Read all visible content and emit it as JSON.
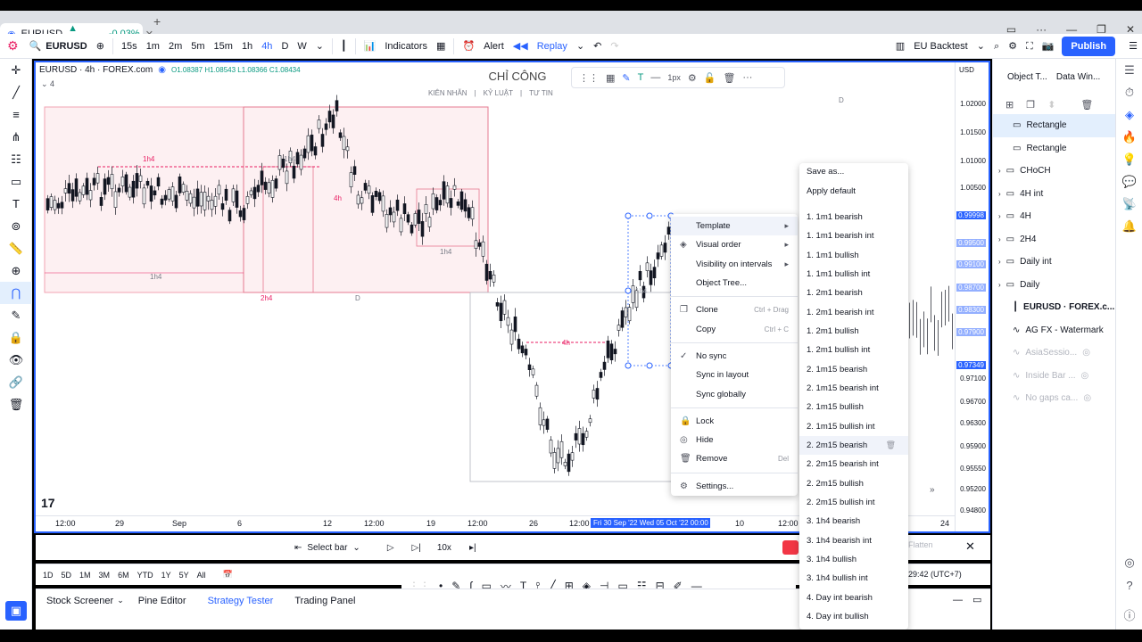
{
  "browser": {
    "tab_title": "EURUSD",
    "tab_price": "▲ 1.09552",
    "tab_change": "-0.03%"
  },
  "header": {
    "symbol": "EURUSD",
    "intervals": [
      "15s",
      "1m",
      "2m",
      "5m",
      "15m",
      "1h",
      "4h",
      "D",
      "W"
    ],
    "indicators_label": "Indicators",
    "alert_label": "Alert",
    "replay_label": "Replay",
    "layout_name": "EU Backtest",
    "publish_label": "Publish"
  },
  "chart": {
    "legend_symbol": "EURUSD · 4h · FOREX.com",
    "ohlc": "O1.08387 H1.08543 L1.08366 C1.08434",
    "indicator_count": "4",
    "watermark_title": "CHỈ CÔNG",
    "watermark_sub": [
      "KIÊN NHẪN",
      "KỶ LUẬT",
      "TƯ TIN"
    ],
    "currency": "USD",
    "labels": {
      "d_top": "D",
      "h4_a": "1h4",
      "h4_b": "1h4",
      "h4_c": "2h4",
      "d_mid": "D",
      "h4_d": "1h4",
      "h4_e": "1h4",
      "h4_f": "4h",
      "h4_g": "1h4",
      "h4_h": "4h"
    }
  },
  "price_axis": [
    "1.02000",
    "1.01500",
    "1.01000",
    "1.00500",
    "0.99998",
    "0.99500",
    "0.99100",
    "0.98700",
    "0.98300",
    "0.97900",
    "0.97349",
    "0.97100",
    "0.96700",
    "0.96300",
    "0.95900",
    "0.95550",
    "0.95200",
    "0.94800"
  ],
  "time_axis": [
    "12:00",
    "29",
    "Sep",
    "6",
    "12",
    "12:00",
    "19",
    "12:00",
    "26",
    "12:00",
    "Fri 30 Sep '22",
    "Wed 05 Oct '22",
    "00:00",
    "10",
    "12:00",
    "24"
  ],
  "context_menu": {
    "items": [
      {
        "label": "Template",
        "arrow": "▸"
      },
      {
        "label": "Visual order",
        "arrow": "▸"
      },
      {
        "label": "Visibility on intervals",
        "arrow": "▸"
      },
      {
        "label": "Object Tree..."
      },
      {
        "label": "Clone",
        "shortcut": "Ctrl + Drag"
      },
      {
        "label": "Copy",
        "shortcut": "Ctrl + C"
      },
      {
        "label": "No sync"
      },
      {
        "label": "Sync in layout"
      },
      {
        "label": "Sync globally"
      },
      {
        "label": "Lock"
      },
      {
        "label": "Hide"
      },
      {
        "label": "Remove",
        "shortcut": "Del"
      },
      {
        "label": "Settings..."
      }
    ]
  },
  "template_menu": {
    "save_as": "Save as...",
    "apply_default": "Apply default",
    "items": [
      "1. 1m1 bearish",
      "1. 1m1 bearish int",
      "1. 1m1 bullish",
      "1. 1m1 bullish int",
      "1. 2m1 bearish",
      "1. 2m1 bearish int",
      "1. 2m1 bullish",
      "1. 2m1 bullish int",
      "2. 1m15 bearish",
      "2. 1m15 bearish int",
      "2. 1m15 bullish",
      "2. 1m15 bullish int",
      "2. 2m15 bearish",
      "2. 2m15 bearish int",
      "2. 2m15 bullish",
      "2. 2m15 bullish int",
      "3. 1h4 bearish",
      "3. 1h4 bearish int",
      "3. 1h4 bullish",
      "3. 1h4 bullish int",
      "4. Day int bearish",
      "4. Day int bullish"
    ]
  },
  "right_panel": {
    "tab_object_tree": "Object T...",
    "tab_data_window": "Data Win...",
    "rows": [
      {
        "label": "Rectangle",
        "selected": true
      },
      {
        "label": "Rectangle"
      },
      {
        "label": "CHoCH",
        "group": true
      },
      {
        "label": "4H int",
        "group": true
      },
      {
        "label": "4H",
        "group": true
      },
      {
        "label": "2H4",
        "group": true
      },
      {
        "label": "Daily int",
        "group": true
      },
      {
        "label": "Daily",
        "group": true
      },
      {
        "label": "EURUSD · FOREX.c...",
        "bold": true
      },
      {
        "label": "AG FX - Watermark"
      },
      {
        "label": "AsiaSessio...",
        "dim": true
      },
      {
        "label": "Inside Bar ...",
        "dim": true
      },
      {
        "label": "No gaps ca...",
        "dim": true
      }
    ]
  },
  "replay_bar": {
    "select_bar": "Select bar",
    "speed": "10x"
  },
  "range_bar": [
    "1D",
    "5D",
    "1M",
    "3M",
    "6M",
    "YTD",
    "1Y",
    "5Y",
    "All"
  ],
  "bottom_tabs": [
    "Stock Screener",
    "Pine Editor",
    "Strategy Tester",
    "Trading Panel"
  ],
  "status": {
    "clock": "29:42 (UTC+7)",
    "flatten": "Flatten"
  },
  "colors": {
    "accent": "#2962ff",
    "bear_box": "#f7d3d7",
    "bear_line": "#e91e63",
    "bull_box": "#ffffff"
  }
}
